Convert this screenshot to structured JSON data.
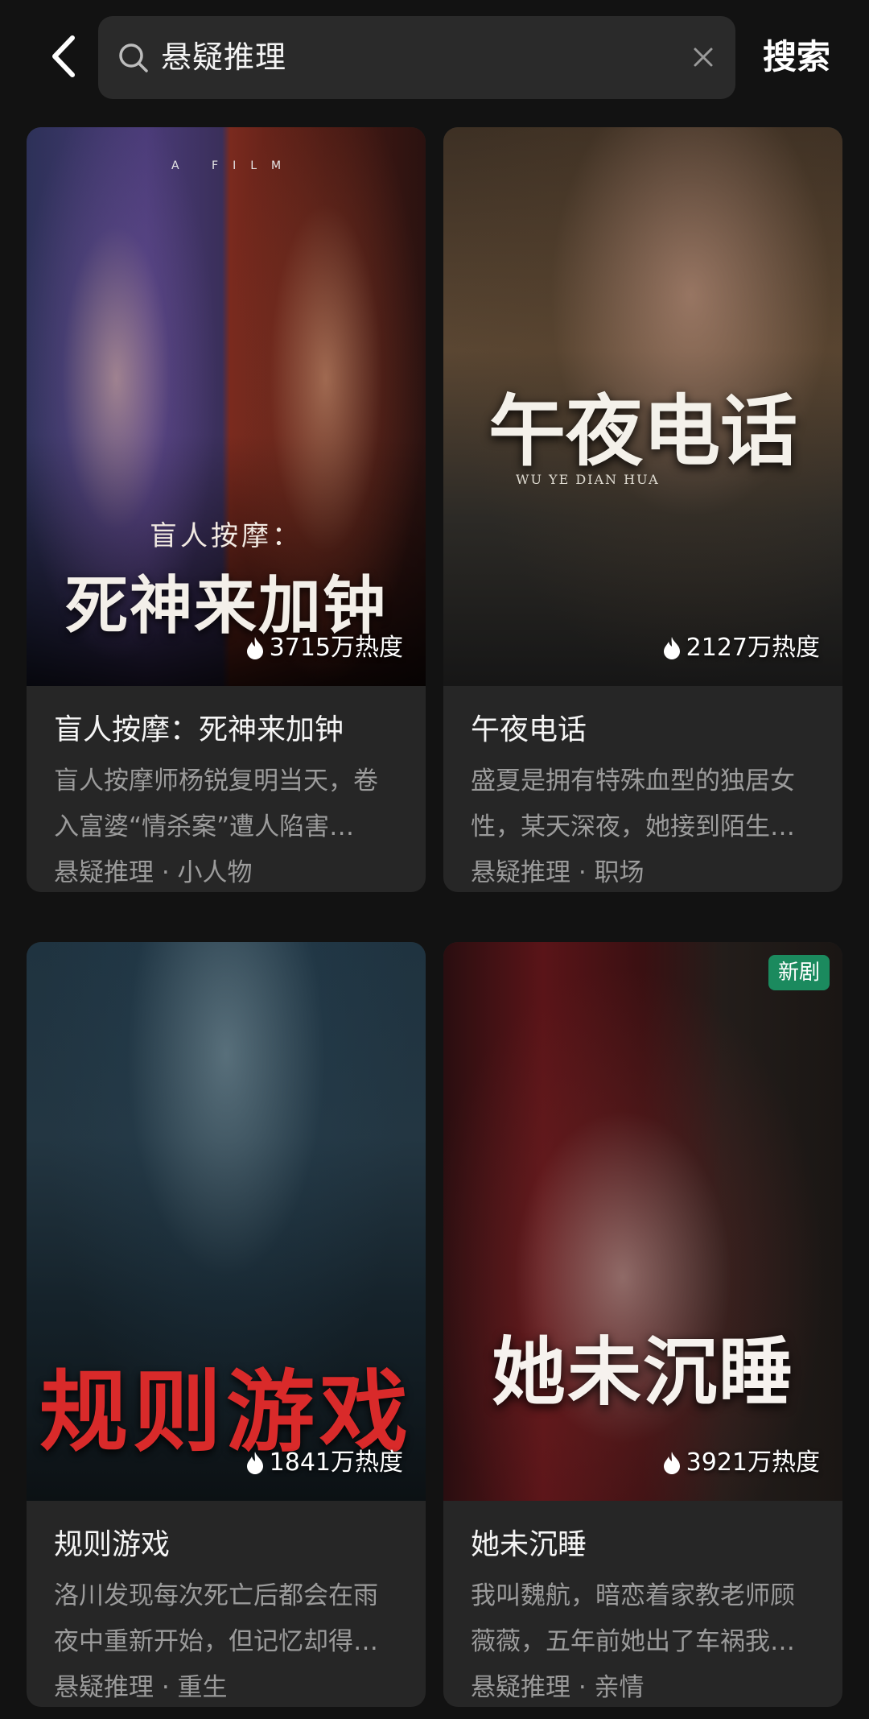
{
  "search": {
    "query": "悬疑推理",
    "submit_label": "搜索"
  },
  "cards": [
    {
      "poster_title": "死神来加钟",
      "poster_subtitle": "盲人按摩：",
      "poster_small_text": "A FILM",
      "heat": "3715万热度",
      "title": "盲人按摩：死神来加钟",
      "description": "盲人按摩师杨锐复明当天，卷入富婆“情杀案”遭人陷害…",
      "tags": "悬疑推理 · 小人物"
    },
    {
      "poster_title": "午夜电话",
      "poster_subtitle": "WU YE DIAN HUA",
      "heat": "2127万热度",
      "title": "午夜电话",
      "description": "盛夏是拥有特殊血型的独居女性，某天深夜，她接到陌生…",
      "tags": "悬疑推理 · 职场"
    },
    {
      "poster_title": "规则游戏",
      "heat": "1841万热度",
      "title": "规则游戏",
      "description": "洛川发现每次死亡后都会在雨夜中重新开始，但记忆却得…",
      "tags": "悬疑推理 · 重生"
    },
    {
      "poster_title": "她未沉睡",
      "badge": "新剧",
      "heat": "3921万热度",
      "title": "她未沉睡",
      "description": "我叫魏航，暗恋着家教老师顾薇薇，五年前她出了车祸我…",
      "tags": "悬疑推理 · 亲情"
    }
  ]
}
